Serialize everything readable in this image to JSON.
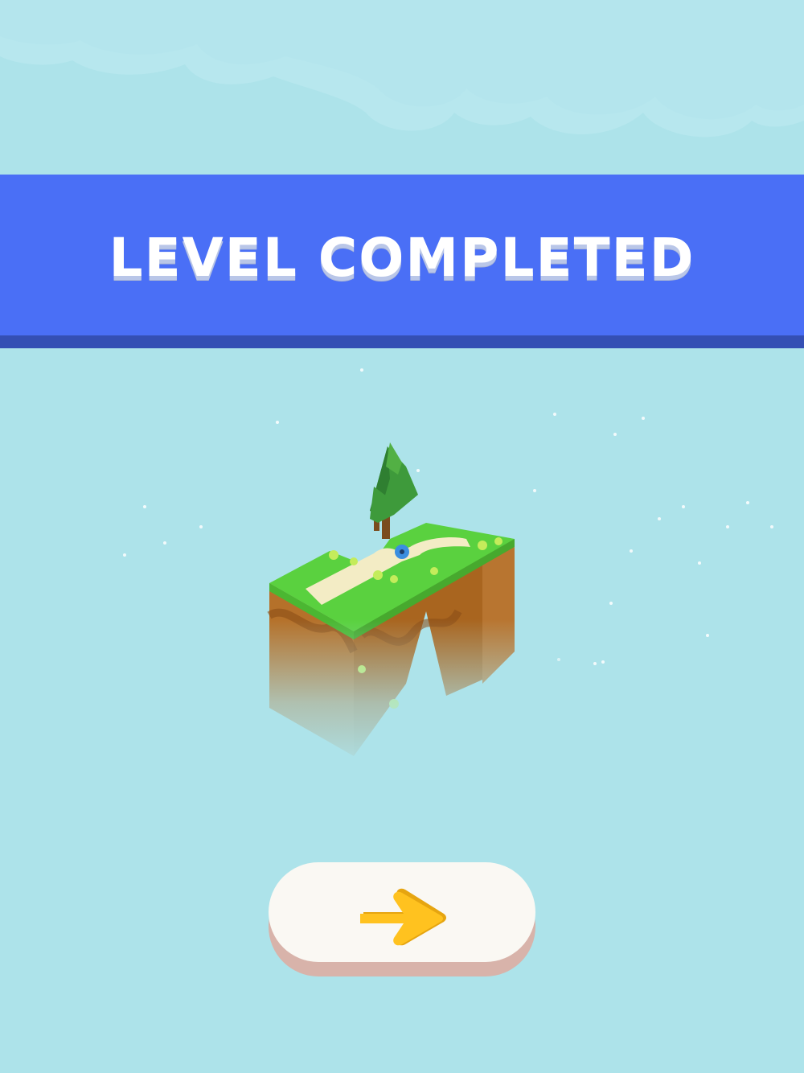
{
  "banner": {
    "title": "LEVEL COMPLETED"
  },
  "colors": {
    "sky": "#ade3ea",
    "cloud": "#b7e7ee",
    "banner": "#4a6ff6",
    "banner_shadow": "#344fb4",
    "grass": "#5ad13f",
    "dirt": "#b5712a",
    "path": "#f3ecc5",
    "button_face": "#faf8f3",
    "button_base": "#d8b3aa",
    "arrow": "#ffc21f"
  },
  "next_button": {
    "icon": "arrow-right-icon"
  },
  "scene": {
    "icon": "floating-island-icon"
  }
}
